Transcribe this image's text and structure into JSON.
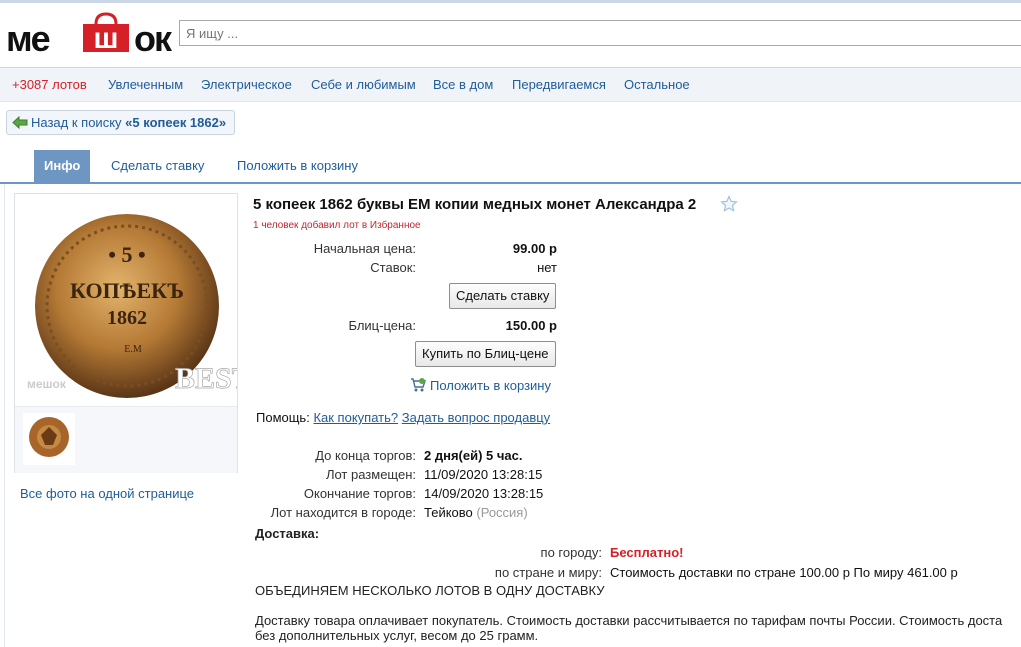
{
  "header": {
    "logo_me": "ме",
    "logo_bag": "ш",
    "logo_ok": "ок",
    "search_placeholder": "Я ищу ..."
  },
  "nav": {
    "count": "+3087 лотов",
    "items": [
      "Увлеченным",
      "Электрическое",
      "Себе и любимым",
      "Все в дом",
      "Передвигаемся",
      "Остальное"
    ]
  },
  "back": {
    "label": "Назад к поиску",
    "query": "«5 копеек 1862»"
  },
  "tabs": [
    "Инфо",
    "Сделать ставку",
    "Положить в корзину"
  ],
  "gallery": {
    "all_photos": "Все фото на одной странице",
    "coin_top": "• 5 •",
    "coin_mid": "КОПѢЕКЪ",
    "coin_year": "1862",
    "coin_mint": "Е.М",
    "watermark_logo": "мешок",
    "watermark_best": "BEST"
  },
  "lot": {
    "title": "5 копеек 1862 буквы ЕМ копии медных монет Александра 2",
    "favorites": "1 человек добавил лот в Избранное",
    "start_price_label": "Начальная цена:",
    "start_price": "99.00 р",
    "bids_label": "Ставок:",
    "bids": "нет",
    "bid_button": "Сделать ставку",
    "blitz_label": "Блиц-цена:",
    "blitz_price": "150.00 р",
    "blitz_button": "Купить по Блиц-цене",
    "cart_link": "Положить в корзину",
    "help_label": "Помощь:",
    "help_how": "Как покупать?",
    "help_ask": "Задать вопрос продавцу",
    "end_label": "До конца торгов:",
    "end_value": "2 дня(ей) 5 час.",
    "placed_label": "Лот размещен:",
    "placed_value": "11/09/2020 13:28:15",
    "finish_label": "Окончание торгов:",
    "finish_value": "14/09/2020 13:28:15",
    "city_label": "Лот находится в городе:",
    "city_value": "Тейково",
    "country_value": "(Россия)"
  },
  "delivery": {
    "heading": "Доставка:",
    "city_label": "по городу:",
    "city_value": "Бесплатно!",
    "country_label": "по стране и миру:",
    "country_value": "Стоимость доставки по стране 100.00 р По миру 461.00 р",
    "combine": "ОБЪЕДИНЯЕМ НЕСКОЛЬКО ЛОТОВ В ОДНУ ДОСТАВКУ",
    "note_line1": "Доставку товара оплачивает покупатель. Стоимость доставки рассчитывается по тарифам почты России. Стоимость доста",
    "note_line2": "без дополнительных услуг, весом до 25 грамм."
  },
  "colors": {
    "link": "#1f5c99",
    "accent_red": "#d62027",
    "tab_active": "#6d96c3"
  }
}
